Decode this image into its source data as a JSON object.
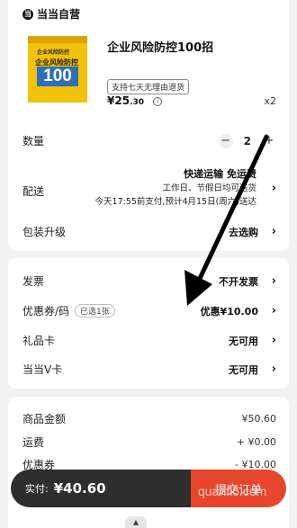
{
  "shop": {
    "name": "当当自营",
    "icon": "dangdang-logo-icon"
  },
  "product": {
    "title": "企业风险防控100招",
    "tag": "支持七天无理由退货",
    "price_main": "¥25",
    "price_decimal": ".30",
    "qty_label": "x2",
    "cover": {
      "top_text": "企业风险防控",
      "mid_text": "企业风险防控",
      "number": "100",
      "bottom_text": ""
    }
  },
  "quantity": {
    "label": "数量",
    "value": "2",
    "minus": "−",
    "plus": "+"
  },
  "delivery": {
    "label": "配送",
    "line1": "快递运输 免运费",
    "line2": "工作日、节假日均可送货",
    "line3": "今天17:55前支付,预计4月15日(周六)送达"
  },
  "packaging": {
    "label": "包装升级",
    "value": "去选购"
  },
  "invoice": {
    "label": "发票",
    "value": "不开发票"
  },
  "coupon": {
    "label": "优惠券/码",
    "badge": "已选1张",
    "value": "优惠¥10.00"
  },
  "gift_card": {
    "label": "礼品卡",
    "value": "无可用"
  },
  "v_card": {
    "label": "当当V卡",
    "value": "无可用"
  },
  "summary": {
    "items": [
      {
        "label": "商品金额",
        "amount": "¥50.60"
      },
      {
        "label": "运费",
        "amount": "+ ¥0.00"
      },
      {
        "label": "优惠券",
        "amount": "- ¥10.00"
      }
    ]
  },
  "checkout": {
    "label": "实付:",
    "total": "¥40.60",
    "button": "提交订单"
  },
  "watermark": "quanfl5.com",
  "pull_handle": "▲",
  "colors": {
    "accent": "#e8452f",
    "bar": "#2e2e2e",
    "book": "#f2c20a"
  }
}
